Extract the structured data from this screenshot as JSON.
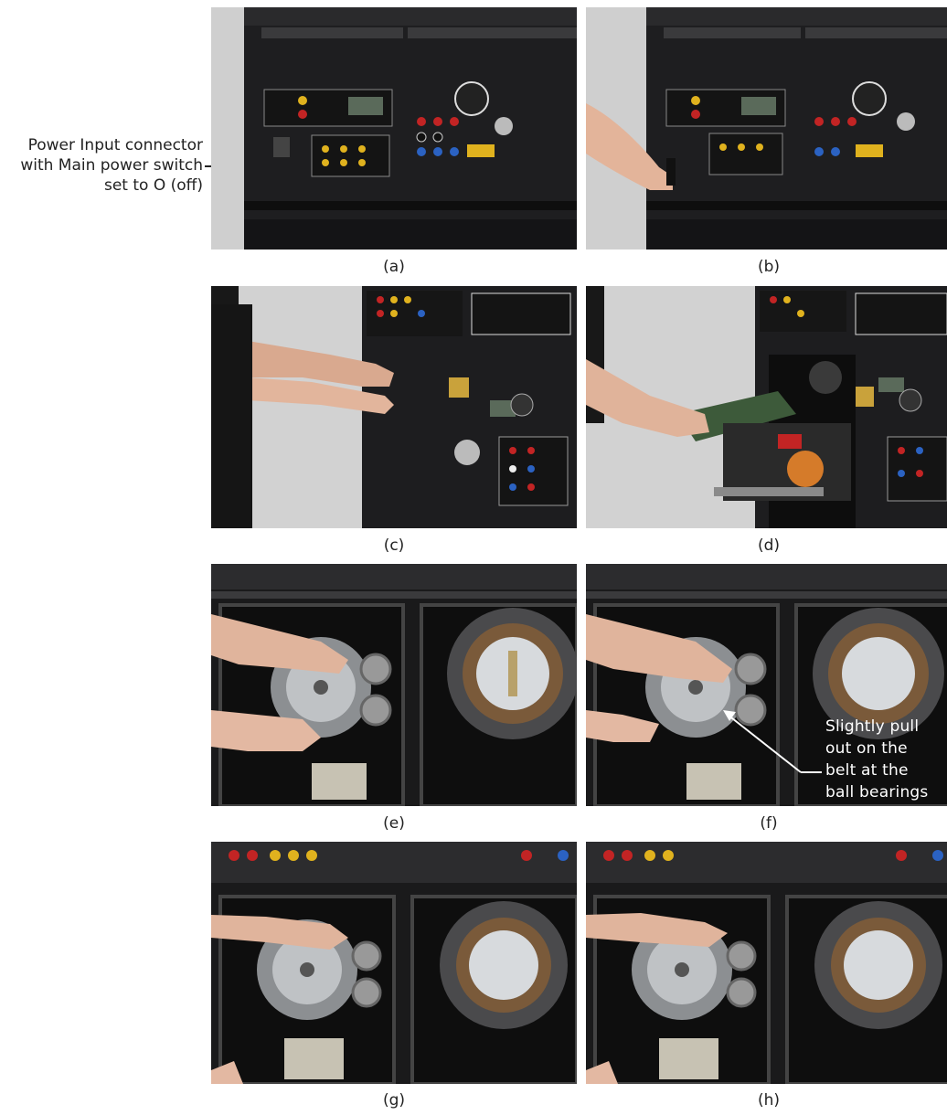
{
  "callout_left": {
    "line1": "Power Input connector",
    "line2": "with Main power switch",
    "line3": "set to O (off)"
  },
  "callout_f": {
    "line1": "Slightly pull",
    "line2": "out on the",
    "line3": "belt at the",
    "line4": "ball bearings"
  },
  "panels": [
    {
      "label": "(a)"
    },
    {
      "label": "(b)"
    },
    {
      "label": "(c)"
    },
    {
      "label": "(d)"
    },
    {
      "label": "(e)"
    },
    {
      "label": "(f)"
    },
    {
      "label": "(g)"
    },
    {
      "label": "(h)"
    }
  ],
  "colors": {
    "panel_black": "#1c1c1d",
    "backdrop_gray": "#c9c9c9",
    "jack_red": "#c22424",
    "jack_blue": "#2b62c2",
    "jack_yellow": "#e0b21e",
    "motor_silver": "#a6a9ac"
  }
}
